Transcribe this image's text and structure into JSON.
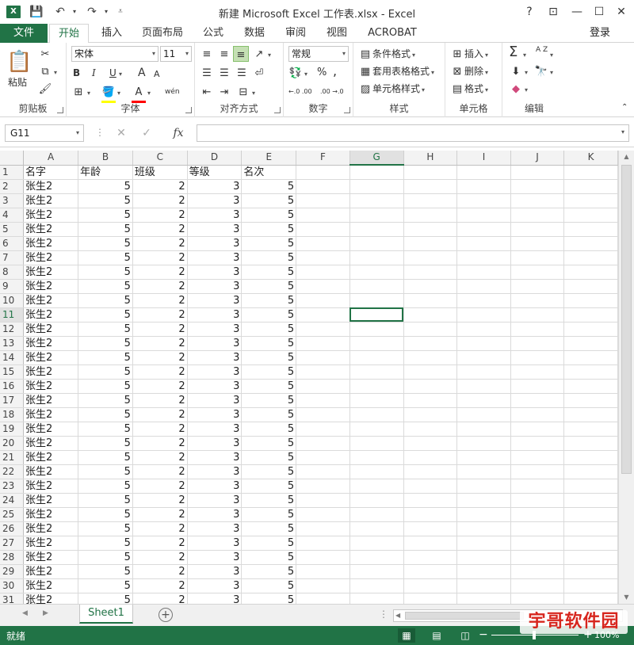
{
  "titlebar": {
    "app_icon": "X",
    "title": "新建 Microsoft Excel 工作表.xlsx - Excel",
    "help": "?",
    "minimize": "—",
    "restore": "☐",
    "close": "✕",
    "ribbon_display": "⊡"
  },
  "tabs": {
    "file": "文件",
    "items": [
      "开始",
      "插入",
      "页面布局",
      "公式",
      "数据",
      "审阅",
      "视图",
      "ACROBAT"
    ],
    "active": "开始",
    "login": "登录"
  },
  "ribbon": {
    "clipboard": {
      "label": "剪贴板",
      "paste": "粘贴"
    },
    "font": {
      "label": "字体",
      "font_name": "宋体",
      "font_size": "11",
      "bold": "B",
      "italic": "I",
      "underline": "U",
      "grow": "A",
      "shrink": "A",
      "wen": "wén"
    },
    "alignment": {
      "label": "对齐方式"
    },
    "number": {
      "label": "数字",
      "format": "常规",
      "percent": "%",
      "comma": ",",
      "inc": "←.0 .00",
      "dec": ".00 →.0"
    },
    "styles": {
      "label": "样式",
      "conditional": "条件格式",
      "table": "套用表格格式",
      "cell": "单元格样式"
    },
    "cells": {
      "label": "单元格",
      "insert": "插入",
      "delete": "删除",
      "format": "格式"
    },
    "editing": {
      "label": "编辑",
      "sigma": "Σ",
      "sort": "A Z",
      "find": "🔭"
    }
  },
  "formula_bar": {
    "name_box": "G11",
    "formula": "",
    "fx": "fx"
  },
  "sheet": {
    "columns": [
      "A",
      "B",
      "C",
      "D",
      "E",
      "F",
      "G",
      "H",
      "I",
      "J",
      "K"
    ],
    "selected_column": "G",
    "selected_row": 11,
    "header_row": [
      "名字",
      "年龄",
      "班级",
      "等级",
      "名次"
    ],
    "data_rows": [
      [
        "张生2",
        "5",
        "2",
        "3",
        "5"
      ],
      [
        "张生2",
        "5",
        "2",
        "3",
        "5"
      ],
      [
        "张生2",
        "5",
        "2",
        "3",
        "5"
      ],
      [
        "张生2",
        "5",
        "2",
        "3",
        "5"
      ],
      [
        "张生2",
        "5",
        "2",
        "3",
        "5"
      ],
      [
        "张生2",
        "5",
        "2",
        "3",
        "5"
      ],
      [
        "张生2",
        "5",
        "2",
        "3",
        "5"
      ],
      [
        "张生2",
        "5",
        "2",
        "3",
        "5"
      ],
      [
        "张生2",
        "5",
        "2",
        "3",
        "5"
      ],
      [
        "张生2",
        "5",
        "2",
        "3",
        "5"
      ],
      [
        "张生2",
        "5",
        "2",
        "3",
        "5"
      ],
      [
        "张生2",
        "5",
        "2",
        "3",
        "5"
      ],
      [
        "张生2",
        "5",
        "2",
        "3",
        "5"
      ],
      [
        "张生2",
        "5",
        "2",
        "3",
        "5"
      ],
      [
        "张生2",
        "5",
        "2",
        "3",
        "5"
      ],
      [
        "张生2",
        "5",
        "2",
        "3",
        "5"
      ],
      [
        "张生2",
        "5",
        "2",
        "3",
        "5"
      ],
      [
        "张生2",
        "5",
        "2",
        "3",
        "5"
      ],
      [
        "张生2",
        "5",
        "2",
        "3",
        "5"
      ],
      [
        "张生2",
        "5",
        "2",
        "3",
        "5"
      ],
      [
        "张生2",
        "5",
        "2",
        "3",
        "5"
      ],
      [
        "张生2",
        "5",
        "2",
        "3",
        "5"
      ],
      [
        "张生2",
        "5",
        "2",
        "3",
        "5"
      ],
      [
        "张生2",
        "5",
        "2",
        "3",
        "5"
      ],
      [
        "张生2",
        "5",
        "2",
        "3",
        "5"
      ],
      [
        "张生2",
        "5",
        "2",
        "3",
        "5"
      ],
      [
        "张生2",
        "5",
        "2",
        "3",
        "5"
      ],
      [
        "张生2",
        "5",
        "2",
        "3",
        "5"
      ],
      [
        "张生2",
        "5",
        "2",
        "3",
        "5"
      ],
      [
        "张生2",
        "5",
        "2",
        "3",
        "5"
      ]
    ]
  },
  "sheet_tabs": {
    "active": "Sheet1",
    "add": "⊕"
  },
  "status": {
    "text": "就绪",
    "zoom": "100%"
  },
  "watermark": "宇哥软件园",
  "colors": {
    "accent": "#217346",
    "active_cell_border": "#217346",
    "watermark": "#d7261e"
  }
}
